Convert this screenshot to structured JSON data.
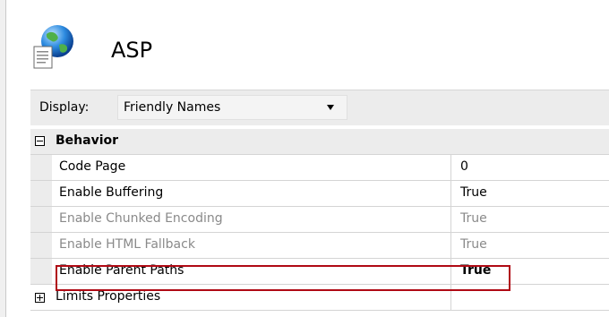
{
  "header": {
    "title": "ASP",
    "icon": "globe-document-icon"
  },
  "toolbar": {
    "display_label": "Display:",
    "display_value": "Friendly Names"
  },
  "grid": {
    "sections": [
      {
        "label": "Behavior",
        "expanded": true,
        "properties": [
          {
            "name": "Code Page",
            "value": "0",
            "enabled": true
          },
          {
            "name": "Enable Buffering",
            "value": "True",
            "enabled": true
          },
          {
            "name": "Enable Chunked Encoding",
            "value": "True",
            "enabled": false
          },
          {
            "name": "Enable HTML Fallback",
            "value": "True",
            "enabled": false
          },
          {
            "name": "Enable Parent Paths",
            "value": "True",
            "enabled": true,
            "highlighted": true
          }
        ]
      },
      {
        "label": "Limits Properties",
        "expanded": false,
        "properties": []
      }
    ]
  },
  "colors": {
    "highlight": "#b00a14",
    "gutter": "#ececec",
    "disabled_text": "#8a8a8a"
  }
}
